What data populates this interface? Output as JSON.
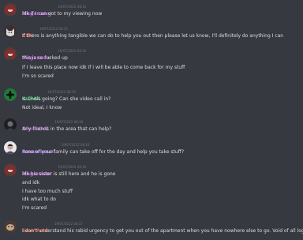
{
  "messages": [
    {
      "author": "Meganzoor",
      "author_color": "#b75be3",
      "avatar": "anime-girl-avatar",
      "timestamp": "19/07/2022 08:15",
      "lines": [
        "idk if I can got to my viewing now"
      ]
    },
    {
      "author": "CSH",
      "author_color": "#e8563a",
      "avatar": "cat-avatar",
      "timestamp": "19/07/2022 08:15",
      "lines": [
        "If there is anything tangible we can do to help you out then please let us know, I'll definitely do anything I can"
      ]
    },
    {
      "author": "Meganzoor",
      "author_color": "#b75be3",
      "avatar": "anime-girl-avatar",
      "timestamp": "19/07/2022 08:15",
      "lines": [
        "this is so fucked up",
        "if I leave this place now idk if I will be able to come back for my stuff",
        "I'm so scared"
      ]
    },
    {
      "author": "KumNL",
      "author_color": "#2ecc71",
      "avatar": "green-logo-avatar",
      "timestamp": "19/07/2022 08:16",
      "lines": [
        "Is Chels going? Can she video call in?",
        "Not ideal, I know"
      ]
    },
    {
      "author": "WindsOrd",
      "author_color": "#9b59b6",
      "avatar": "dark-character-avatar",
      "timestamp": "19/07/2022 08:16",
      "lines": [
        "Any friends in the area that can help?"
      ]
    },
    {
      "author": "Rassorkrewl",
      "author_color": "#a970ff",
      "avatar": "portrait-avatar",
      "timestamp": "19/07/2022 08:16",
      "lines": [
        "none of your family can take off for the day and help you take stuff?"
      ]
    },
    {
      "author": "Meganzoor",
      "author_color": "#b75be3",
      "avatar": "anime-girl-avatar",
      "timestamp": "19/07/2022 08:16",
      "lines": [
        "idk his sister is still here and he is gone",
        "and idk",
        "I have too much stuff",
        "idk what to do",
        "I'm scared"
      ]
    },
    {
      "author": "Scav Pets",
      "author_color": "#e8563a",
      "avatar": "creature-avatar",
      "timestamp": "19/07/2022 08:17",
      "lines": [
        "I don't understand his rabid urgency to get you out of the apartment when you have nowhere else to go. Void of all logic."
      ]
    }
  ]
}
